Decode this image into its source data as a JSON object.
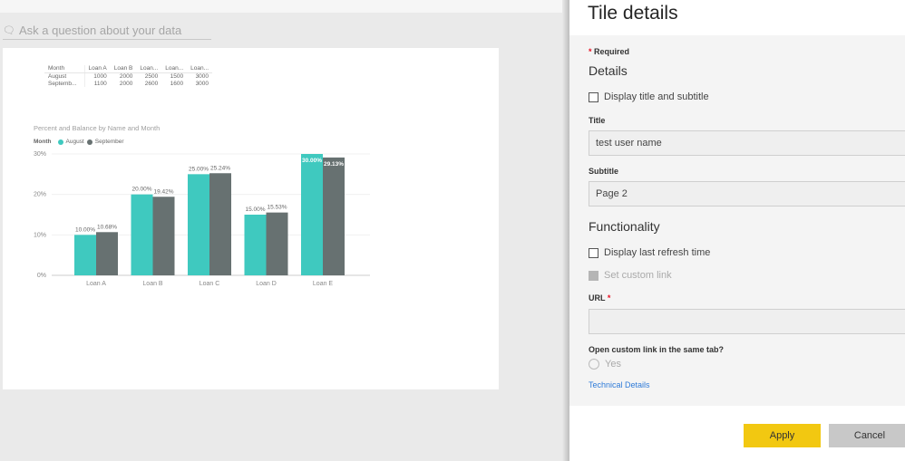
{
  "qa": {
    "icon": "speech-bubble-icon",
    "placeholder": "Ask a question about your data"
  },
  "table": {
    "headers": [
      "Month",
      "Loan A",
      "Loan B",
      "Loan...",
      "Loan...",
      "Loan..."
    ],
    "rows": [
      [
        "August",
        "1000",
        "2000",
        "2500",
        "1500",
        "3000"
      ],
      [
        "Septemb...",
        "1100",
        "2000",
        "2600",
        "1600",
        "3000"
      ]
    ]
  },
  "chart_data": {
    "type": "bar",
    "title": "Percent and Balance by Name and Month",
    "legend_title": "Month",
    "legend_placement": "top-left",
    "categories": [
      "Loan A",
      "Loan B",
      "Loan C",
      "Loan D",
      "Loan E"
    ],
    "series": [
      {
        "name": "August",
        "color": "#3fc9bf",
        "values": [
          10.0,
          20.0,
          25.0,
          15.0,
          30.0
        ],
        "labels": [
          "10.00%",
          "20.00%",
          "25.00%",
          "15.00%",
          "30.00%"
        ]
      },
      {
        "name": "September",
        "color": "#677171",
        "values": [
          10.68,
          19.42,
          25.24,
          15.53,
          29.13
        ],
        "labels": [
          "10.68%",
          "19.42%",
          "25.24%",
          "15.53%",
          "29.13%"
        ]
      }
    ],
    "ylim": [
      0,
      30
    ],
    "yticks": [
      "0%",
      "10%",
      "20%",
      "30%"
    ],
    "grid": true
  },
  "panel": {
    "title": "Tile details",
    "required": "Required",
    "details_heading": "Details",
    "display_title_label": "Display title and subtitle",
    "display_title_checked": false,
    "title_label": "Title",
    "title_value": "test user name",
    "subtitle_label": "Subtitle",
    "subtitle_value": "Page 2",
    "functionality_heading": "Functionality",
    "refresh_label": "Display last refresh time",
    "refresh_checked": false,
    "custom_link_label": "Set custom link",
    "url_label": "URL",
    "url_value": "",
    "same_tab_label": "Open custom link in the same tab?",
    "yes_label": "Yes",
    "technical_details": "Technical Details",
    "apply": "Apply",
    "cancel": "Cancel",
    "colors": {
      "apply": "#f2c811",
      "cancel": "#c8c8c8",
      "link": "#2f7bd8",
      "required": "#e81123"
    }
  }
}
